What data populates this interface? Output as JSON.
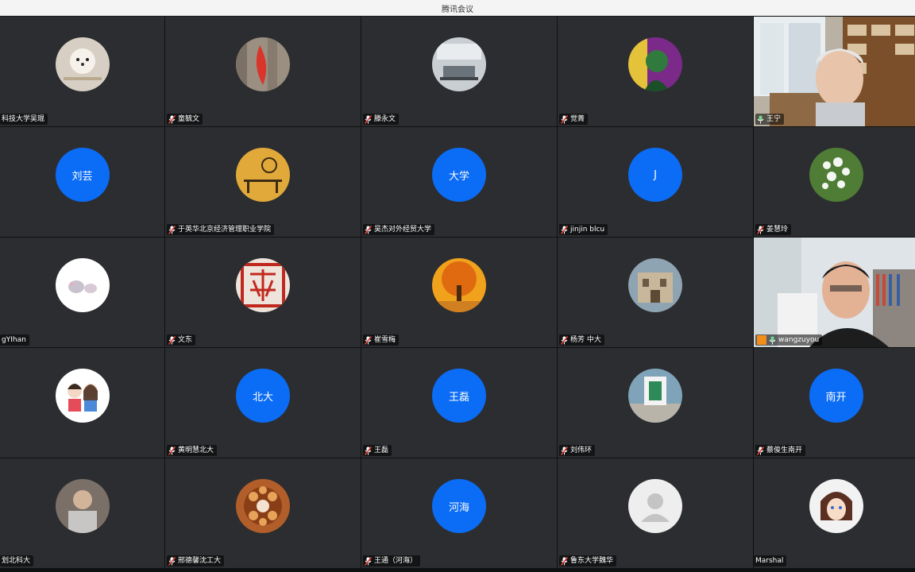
{
  "window": {
    "title": "腾讯会议"
  },
  "participants": [
    {
      "name": "科技大学吴琨",
      "avatar": "dog-photo",
      "mic": "none"
    },
    {
      "name": "童毓文",
      "avatar": "leaf-photo",
      "mic": "muted"
    },
    {
      "name": "滕永文",
      "avatar": "room-photo",
      "mic": "muted"
    },
    {
      "name": "觉菁",
      "avatar": "painting-photo",
      "mic": "muted"
    },
    {
      "name": "王宁",
      "avatar": "video",
      "mic": "active"
    },
    {
      "name": "",
      "avatar_text": "刘芸",
      "mic": "none"
    },
    {
      "name": "于英华北京经济管理职业学院",
      "avatar": "interior-photo",
      "mic": "muted"
    },
    {
      "name": "吴杰对外经贸大学",
      "avatar_text": "大学",
      "mic": "muted"
    },
    {
      "name": "jinjin blcu",
      "avatar_text": "J",
      "mic": "muted"
    },
    {
      "name": "姜慧玲",
      "avatar": "flower-photo",
      "mic": "muted"
    },
    {
      "name": "gYIhan",
      "avatar": "elephant-photo",
      "mic": "none"
    },
    {
      "name": "文东",
      "avatar": "seal-photo",
      "mic": "muted"
    },
    {
      "name": "崔雪梅",
      "avatar": "autumn-tree-photo",
      "mic": "muted"
    },
    {
      "name": "杨芳 中大",
      "avatar": "building-photo",
      "mic": "muted"
    },
    {
      "name": "wangzuyou",
      "avatar": "video",
      "mic": "active",
      "sharing": true
    },
    {
      "name": "",
      "avatar": "cartoon-couple-photo",
      "mic": "none"
    },
    {
      "name": "黄明慧北大",
      "avatar_text": "北大",
      "mic": "muted"
    },
    {
      "name": "王磊",
      "avatar_text": "王磊",
      "mic": "muted"
    },
    {
      "name": "刘伟环",
      "avatar": "campus-photo",
      "mic": "muted"
    },
    {
      "name": "蔡俊生南开",
      "avatar_text": "南开",
      "mic": "muted"
    },
    {
      "name": "划北科大",
      "avatar": "person-photo",
      "mic": "none"
    },
    {
      "name": "邢德馨沈工大",
      "avatar": "food-photo",
      "mic": "muted"
    },
    {
      "name": "王通（河海）",
      "avatar_text": "河海",
      "mic": "muted"
    },
    {
      "name": "鲁东大学魏华",
      "avatar": "default-user-icon",
      "mic": "muted"
    },
    {
      "name": "Marshal",
      "avatar": "anime-photo",
      "mic": "none"
    }
  ],
  "colors": {
    "tile_bg": "#2c2d30",
    "avatar_blue": "#0b6cf5",
    "active_speaker": "#27c46a",
    "mic_muted": "#e0403a"
  }
}
